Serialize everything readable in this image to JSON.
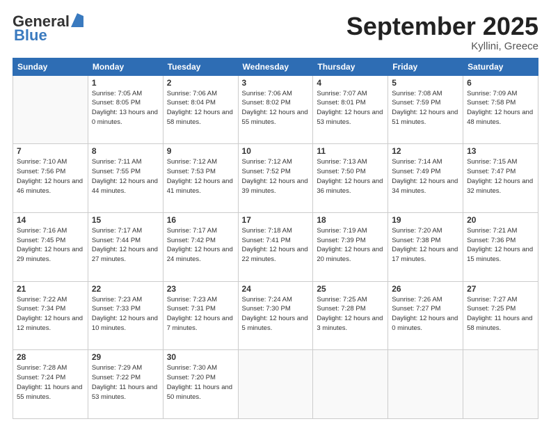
{
  "header": {
    "logo_line1": "General",
    "logo_line2": "Blue",
    "month": "September 2025",
    "location": "Kyllini, Greece"
  },
  "days_of_week": [
    "Sunday",
    "Monday",
    "Tuesday",
    "Wednesday",
    "Thursday",
    "Friday",
    "Saturday"
  ],
  "weeks": [
    [
      {
        "num": "",
        "empty": true
      },
      {
        "num": "1",
        "sunrise": "Sunrise: 7:05 AM",
        "sunset": "Sunset: 8:05 PM",
        "daylight": "Daylight: 13 hours and 0 minutes."
      },
      {
        "num": "2",
        "sunrise": "Sunrise: 7:06 AM",
        "sunset": "Sunset: 8:04 PM",
        "daylight": "Daylight: 12 hours and 58 minutes."
      },
      {
        "num": "3",
        "sunrise": "Sunrise: 7:06 AM",
        "sunset": "Sunset: 8:02 PM",
        "daylight": "Daylight: 12 hours and 55 minutes."
      },
      {
        "num": "4",
        "sunrise": "Sunrise: 7:07 AM",
        "sunset": "Sunset: 8:01 PM",
        "daylight": "Daylight: 12 hours and 53 minutes."
      },
      {
        "num": "5",
        "sunrise": "Sunrise: 7:08 AM",
        "sunset": "Sunset: 7:59 PM",
        "daylight": "Daylight: 12 hours and 51 minutes."
      },
      {
        "num": "6",
        "sunrise": "Sunrise: 7:09 AM",
        "sunset": "Sunset: 7:58 PM",
        "daylight": "Daylight: 12 hours and 48 minutes."
      }
    ],
    [
      {
        "num": "7",
        "sunrise": "Sunrise: 7:10 AM",
        "sunset": "Sunset: 7:56 PM",
        "daylight": "Daylight: 12 hours and 46 minutes."
      },
      {
        "num": "8",
        "sunrise": "Sunrise: 7:11 AM",
        "sunset": "Sunset: 7:55 PM",
        "daylight": "Daylight: 12 hours and 44 minutes."
      },
      {
        "num": "9",
        "sunrise": "Sunrise: 7:12 AM",
        "sunset": "Sunset: 7:53 PM",
        "daylight": "Daylight: 12 hours and 41 minutes."
      },
      {
        "num": "10",
        "sunrise": "Sunrise: 7:12 AM",
        "sunset": "Sunset: 7:52 PM",
        "daylight": "Daylight: 12 hours and 39 minutes."
      },
      {
        "num": "11",
        "sunrise": "Sunrise: 7:13 AM",
        "sunset": "Sunset: 7:50 PM",
        "daylight": "Daylight: 12 hours and 36 minutes."
      },
      {
        "num": "12",
        "sunrise": "Sunrise: 7:14 AM",
        "sunset": "Sunset: 7:49 PM",
        "daylight": "Daylight: 12 hours and 34 minutes."
      },
      {
        "num": "13",
        "sunrise": "Sunrise: 7:15 AM",
        "sunset": "Sunset: 7:47 PM",
        "daylight": "Daylight: 12 hours and 32 minutes."
      }
    ],
    [
      {
        "num": "14",
        "sunrise": "Sunrise: 7:16 AM",
        "sunset": "Sunset: 7:45 PM",
        "daylight": "Daylight: 12 hours and 29 minutes."
      },
      {
        "num": "15",
        "sunrise": "Sunrise: 7:17 AM",
        "sunset": "Sunset: 7:44 PM",
        "daylight": "Daylight: 12 hours and 27 minutes."
      },
      {
        "num": "16",
        "sunrise": "Sunrise: 7:17 AM",
        "sunset": "Sunset: 7:42 PM",
        "daylight": "Daylight: 12 hours and 24 minutes."
      },
      {
        "num": "17",
        "sunrise": "Sunrise: 7:18 AM",
        "sunset": "Sunset: 7:41 PM",
        "daylight": "Daylight: 12 hours and 22 minutes."
      },
      {
        "num": "18",
        "sunrise": "Sunrise: 7:19 AM",
        "sunset": "Sunset: 7:39 PM",
        "daylight": "Daylight: 12 hours and 20 minutes."
      },
      {
        "num": "19",
        "sunrise": "Sunrise: 7:20 AM",
        "sunset": "Sunset: 7:38 PM",
        "daylight": "Daylight: 12 hours and 17 minutes."
      },
      {
        "num": "20",
        "sunrise": "Sunrise: 7:21 AM",
        "sunset": "Sunset: 7:36 PM",
        "daylight": "Daylight: 12 hours and 15 minutes."
      }
    ],
    [
      {
        "num": "21",
        "sunrise": "Sunrise: 7:22 AM",
        "sunset": "Sunset: 7:34 PM",
        "daylight": "Daylight: 12 hours and 12 minutes."
      },
      {
        "num": "22",
        "sunrise": "Sunrise: 7:23 AM",
        "sunset": "Sunset: 7:33 PM",
        "daylight": "Daylight: 12 hours and 10 minutes."
      },
      {
        "num": "23",
        "sunrise": "Sunrise: 7:23 AM",
        "sunset": "Sunset: 7:31 PM",
        "daylight": "Daylight: 12 hours and 7 minutes."
      },
      {
        "num": "24",
        "sunrise": "Sunrise: 7:24 AM",
        "sunset": "Sunset: 7:30 PM",
        "daylight": "Daylight: 12 hours and 5 minutes."
      },
      {
        "num": "25",
        "sunrise": "Sunrise: 7:25 AM",
        "sunset": "Sunset: 7:28 PM",
        "daylight": "Daylight: 12 hours and 3 minutes."
      },
      {
        "num": "26",
        "sunrise": "Sunrise: 7:26 AM",
        "sunset": "Sunset: 7:27 PM",
        "daylight": "Daylight: 12 hours and 0 minutes."
      },
      {
        "num": "27",
        "sunrise": "Sunrise: 7:27 AM",
        "sunset": "Sunset: 7:25 PM",
        "daylight": "Daylight: 11 hours and 58 minutes."
      }
    ],
    [
      {
        "num": "28",
        "sunrise": "Sunrise: 7:28 AM",
        "sunset": "Sunset: 7:24 PM",
        "daylight": "Daylight: 11 hours and 55 minutes."
      },
      {
        "num": "29",
        "sunrise": "Sunrise: 7:29 AM",
        "sunset": "Sunset: 7:22 PM",
        "daylight": "Daylight: 11 hours and 53 minutes."
      },
      {
        "num": "30",
        "sunrise": "Sunrise: 7:30 AM",
        "sunset": "Sunset: 7:20 PM",
        "daylight": "Daylight: 11 hours and 50 minutes."
      },
      {
        "num": "",
        "empty": true
      },
      {
        "num": "",
        "empty": true
      },
      {
        "num": "",
        "empty": true
      },
      {
        "num": "",
        "empty": true
      }
    ]
  ]
}
